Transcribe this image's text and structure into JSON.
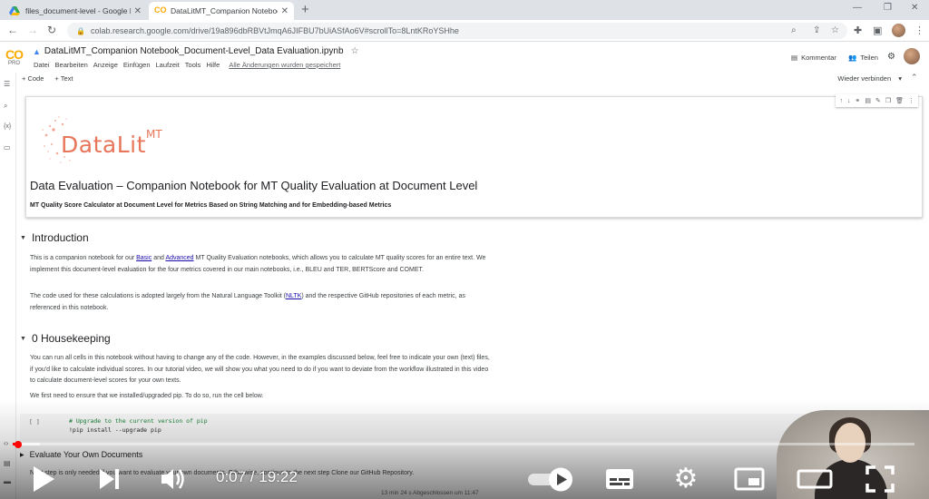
{
  "browser": {
    "tabs": [
      {
        "title": "files_document-level - Google D",
        "active": false
      },
      {
        "title": "DataLitMT_Companion Notebook_",
        "active": true
      }
    ],
    "url": "colab.research.google.com/drive/19a896dbRBVtJmqA6JIFBU7bUiASfAo6V#scrollTo=8LntKRoYSHhe"
  },
  "colab": {
    "logo": "CO",
    "logo_sub": "PRO",
    "notebook_title": "DataLitMT_Companion Notebook_Document-Level_Data Evaluation.ipynb",
    "menu": [
      "Datei",
      "Bearbeiten",
      "Anzeige",
      "Einfügen",
      "Laufzeit",
      "Tools",
      "Hilfe"
    ],
    "saved_status": "Alle Änderungen wurden gespeichert",
    "comment_label": "Kommentar",
    "share_label": "Teilen",
    "add_code": "+ Code",
    "add_text": "+ Text",
    "reconnect": "Wieder verbinden"
  },
  "notebook": {
    "logo_text": "DataLit",
    "logo_sup": "MT",
    "title": "Data Evaluation – Companion Notebook for MT Quality Evaluation at Document Level",
    "subtitle": "MT Quality Score Calculator at Document Level for Metrics Based on String Matching and for Embedding-based Metrics",
    "intro_heading": "Introduction",
    "intro_p1_a": "This is a companion notebook for our ",
    "intro_link_basic": "Basic",
    "intro_p1_b": " and ",
    "intro_link_advanced": "Advanced",
    "intro_p1_c": " MT Quality Evaluation notebooks, which allows you to calculate MT quality scores for an entire text. We implement this document-level evaluation for the four metrics covered in our main notebooks, i.e., BLEU and TER, BERTScore and COMET.",
    "intro_p2_a": "The code used for these calculations is adopted largely from the Natural Language Toolkit (",
    "intro_link_nltk": "NLTK",
    "intro_p2_b": ") and the respective GitHub repositories of each metric, as referenced in this notebook.",
    "housekeeping_heading": "0 Housekeeping",
    "hk_p1": "You can run all cells in this notebook without having to change any of the code. However, in the examples discussed below, feel free to indicate your own (text) files, if you'd like to calculate individual scores. In our tutorial video, we will show you what you need to do if you want to deviate from the workflow illustrated in this video to calculate document-level scores for your own texts.",
    "hk_p2": "We first need to ensure that we installed/upgraded pip. To do so, run the cell below.",
    "code_run": "[ ]",
    "code_line1": "# Upgrade to the current version of pip",
    "code_line2": "!pip install --upgrade pip",
    "evaluate_heading": "Evaluate Your Own Documents",
    "evaluate_p": "Next step is only needed if you want to evaluate your own documents. Otherwise, continue to the next step Clone our GitHub Repository.",
    "status": "13 min 24 s   Abgeschlossen um 11:47"
  },
  "video": {
    "current_time": "0:07",
    "duration": "19:22",
    "time_display": "0:07 / 19:22",
    "progress_fraction": 0.006,
    "buffered_fraction": 0.03
  },
  "colors": {
    "accent_red": "#ff0000",
    "colab_orange": "#f9ab00",
    "logo_coral": "#e8765a",
    "link": "#1a0dab"
  }
}
